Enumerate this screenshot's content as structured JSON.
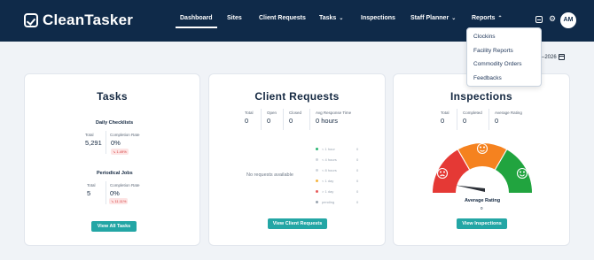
{
  "brand": {
    "name": "CleanTasker"
  },
  "nav": {
    "dashboard": "Dashboard",
    "sites": "Sites",
    "client_requests": "Client Requests",
    "tasks": "Tasks",
    "inspections": "Inspections",
    "staff_planner": "Staff Planner",
    "reports": "Reports"
  },
  "user": {
    "initials": "AM"
  },
  "date_suffix": "–2026",
  "reports_menu": [
    "Clockins",
    "Facility Reports",
    "Commodity Orders",
    "Feedbacks"
  ],
  "tasks": {
    "title": "Tasks",
    "daily": {
      "heading": "Daily Checklists",
      "total_label": "Total",
      "total": "5,291",
      "rate_label": "Completion Rate",
      "rate": "0%",
      "trend": "↘ 1.49%"
    },
    "periodical": {
      "heading": "Periodical Jobs",
      "total_label": "Total",
      "total": "5",
      "rate_label": "Completion Rate",
      "rate": "0%",
      "trend": "↘ 11.11%"
    },
    "button": "View All Tasks"
  },
  "client_requests": {
    "title": "Client Requests",
    "stats": [
      {
        "label": "Total",
        "value": "0"
      },
      {
        "label": "Open",
        "value": "0"
      },
      {
        "label": "Closed",
        "value": "0"
      },
      {
        "label": "Avg Response Time",
        "value": "0 hours"
      }
    ],
    "empty": "No requests available",
    "legend": [
      {
        "label": "< 1 hour",
        "value": "0",
        "color": "#2bb673"
      },
      {
        "label": "< 4 hours",
        "value": "0",
        "color": "#cfd5dc"
      },
      {
        "label": "< 8 hours",
        "value": "0",
        "color": "#cfd5dc"
      },
      {
        "label": "< 1 day",
        "value": "0",
        "color": "#f5b540"
      },
      {
        "label": "> 1 day",
        "value": "0",
        "color": "#e85d5d"
      },
      {
        "label": "pending",
        "value": "0",
        "color": "#9aa4b0"
      }
    ],
    "button": "View Client Requests"
  },
  "inspections": {
    "title": "Inspections",
    "stats": [
      {
        "label": "Total",
        "value": "0"
      },
      {
        "label": "Completed",
        "value": "0"
      },
      {
        "label": "Average Rating",
        "value": "0"
      }
    ],
    "gauge_colors": {
      "bad": "#e53935",
      "mid": "#f5821f",
      "good": "#21a43f"
    },
    "avg_label": "Average Rating",
    "avg_value": "0",
    "button": "View Inspections"
  }
}
